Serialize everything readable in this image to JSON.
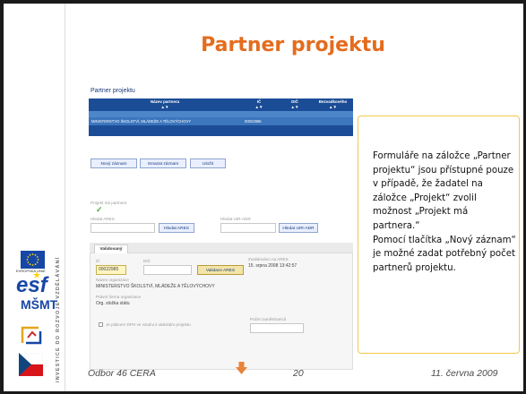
{
  "slide": {
    "title": "Partner projektu",
    "vertical_text": "INVESTICE DO ROZVOJE VZDĚLÁVÁNÍ",
    "logos": {
      "eu_label": "EVROPSKÁ UNIE",
      "esf": "esf",
      "msmt": "MŠMT"
    },
    "colors": {
      "title": "#e46c1e",
      "callout_border": "#f2c94c",
      "grid": "#1b4d96"
    }
  },
  "form": {
    "title": "Partner projektu",
    "grid": {
      "headers": [
        "Název partnera",
        "IČ",
        "DIČ",
        "Bezvadkového"
      ],
      "sort_marks": "▲▼",
      "rows": [
        [
          "MINISTERSTVO ŠKOLSTVÍ, MLÁDEŽE A TĚLOVÝCHOVY",
          "00022985",
          "",
          ""
        ]
      ]
    },
    "buttons": {
      "new_record": "Nový záznam",
      "delete_record": "Smazat záznam",
      "save": "Uložit"
    },
    "project_has_partner_label": "Projekt má partnera",
    "checkmark": "✓",
    "ares_search_label": "Hledat ARES",
    "ares_button": "Hledat ARES",
    "uir_search_label": "Hledat UIR-ADR",
    "uir_button": "Hledat UIR-ADR",
    "tab_label": "Validovaný",
    "ic_label": "IČ",
    "ic_value": "00022985",
    "dic_label": "DIČ",
    "validate_button": "Validace ARES",
    "validated_label": "Zvalidováno na ARES",
    "validated_value": "15. srpna 2008 13:42:57",
    "org_name_label": "Název organizace",
    "org_name_value": "MINISTERSTVO ŠKOLSTVÍ, MLÁDEŽE A TĚLOVÝCHOVY",
    "legal_form_label": "Právní forma organizace",
    "legal_form_value": "Org. složka státu",
    "vat_checkbox_label": "Je plátcem DPH ve vztahu k aktivitám projektu",
    "employees_label": "Počet zaměstnanců"
  },
  "callout": {
    "text": "Formuláře na záložce „Partner projektu“ jsou přístupné pouze v případě, že žadatel na záložce „Projekt“ zvolil možnost „Projekt má partnera.“\nPomocí tlačítka „Nový záznam“ je možné zadat potřebný počet partnerů projektu."
  },
  "footer": {
    "left": "Odbor 46 CERA",
    "center": "20",
    "right": "11. června 2009"
  }
}
